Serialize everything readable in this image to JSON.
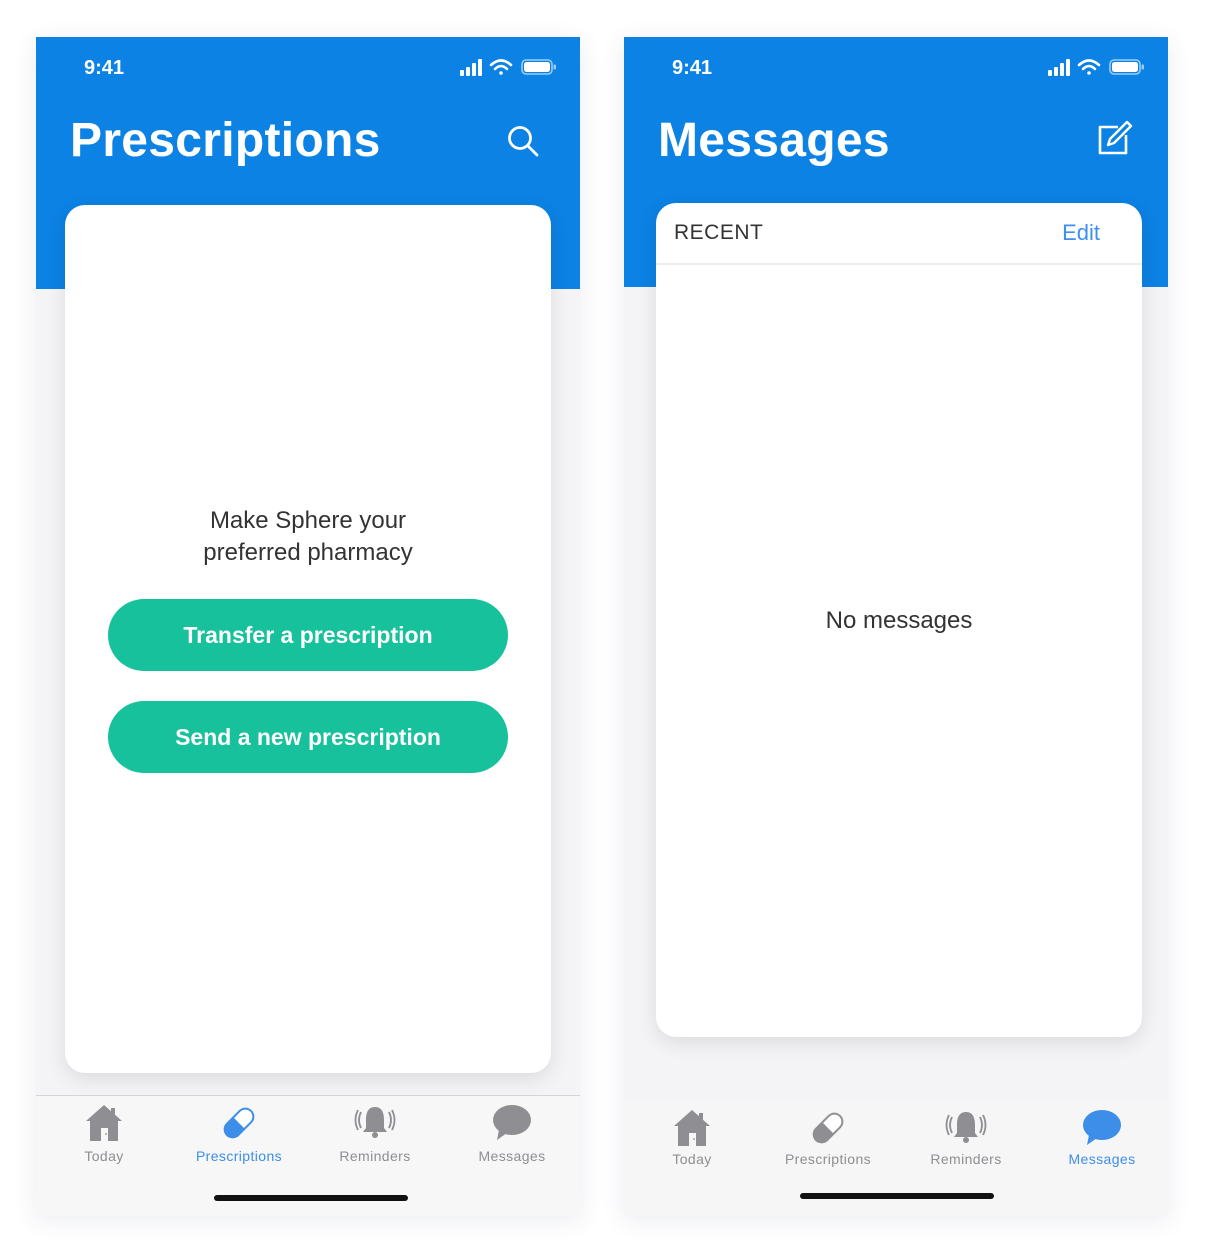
{
  "colors": {
    "header_blue": "#0c82e4",
    "button_green": "#17c19b",
    "tab_active": "#3c8ee9",
    "tab_inactive": "#8e8e93"
  },
  "status_bar": {
    "time": "9:41"
  },
  "screens": {
    "prescriptions": {
      "title": "Prescriptions",
      "header_icon": "search-icon",
      "empty_state_line1": "Make Sphere your",
      "empty_state_line2": "preferred pharmacy",
      "primary_button": "Transfer a prescription",
      "secondary_button": "Send a new prescription"
    },
    "messages": {
      "title": "Messages",
      "header_icon": "compose-icon",
      "section_label": "RECENT",
      "edit_label": "Edit",
      "empty_state": "No messages"
    }
  },
  "tabbar": {
    "tabs": [
      {
        "label": "Today",
        "icon": "house-icon"
      },
      {
        "label": "Prescriptions",
        "icon": "pill-icon"
      },
      {
        "label": "Reminders",
        "icon": "bell-icon"
      },
      {
        "label": "Messages",
        "icon": "chat-bubble-icon"
      }
    ],
    "left_active": "Prescriptions",
    "right_active": "Messages"
  }
}
